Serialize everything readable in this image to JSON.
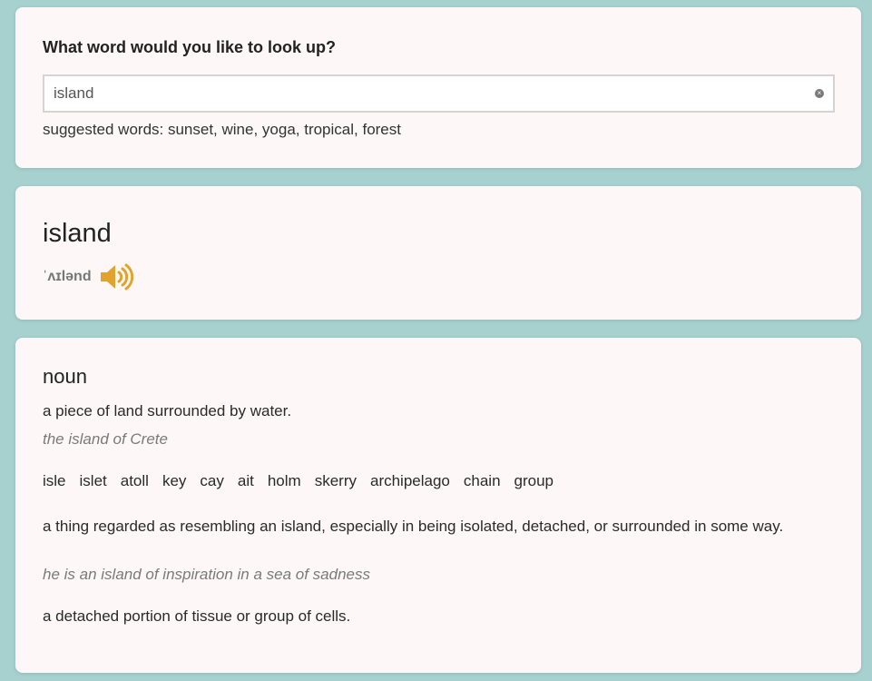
{
  "search": {
    "prompt": "What word would you like to look up?",
    "value": "island",
    "suggested": "suggested words: sunset, wine, yoga, tropical, forest"
  },
  "entry": {
    "word": "island",
    "phonetic": "ˈʌɪlənd",
    "audio_color": "#e0a32e"
  },
  "meaning": {
    "part_of_speech": "noun",
    "definitions": [
      {
        "text": "a piece of land surrounded by water.",
        "example": "the island of Crete"
      },
      {
        "text": "a thing regarded as resembling an island, especially in being isolated, detached, or surrounded in some way.",
        "example": "he is an island of inspiration in a sea of sadness"
      },
      {
        "text": "a detached portion of tissue or group of cells."
      }
    ],
    "synonyms": [
      "isle",
      "islet",
      "atoll",
      "key",
      "cay",
      "ait",
      "holm",
      "skerry",
      "archipelago",
      "chain",
      "group"
    ]
  }
}
